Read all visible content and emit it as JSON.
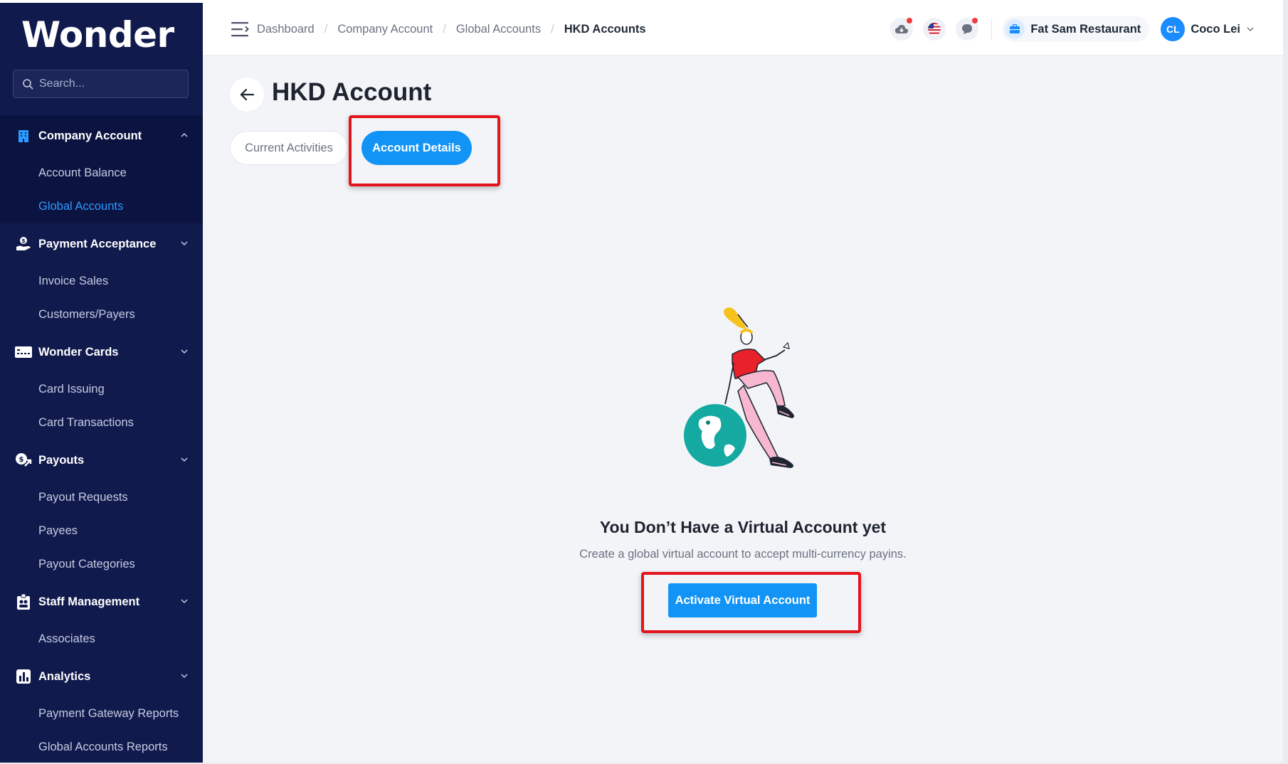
{
  "app": {
    "brand": "Wonder"
  },
  "search": {
    "placeholder": "Search..."
  },
  "sidebar": {
    "sections": [
      {
        "label": "Company Account",
        "icon": "building-icon",
        "expanded": true,
        "items": [
          {
            "label": "Account Balance"
          },
          {
            "label": "Global Accounts",
            "active": true
          }
        ]
      },
      {
        "label": "Payment Acceptance",
        "icon": "hand-dollar-icon",
        "items": [
          {
            "label": "Invoice Sales"
          },
          {
            "label": "Customers/Payers"
          }
        ]
      },
      {
        "label": "Wonder Cards",
        "icon": "card-icon",
        "items": [
          {
            "label": "Card Issuing"
          },
          {
            "label": "Card Transactions"
          }
        ]
      },
      {
        "label": "Payouts",
        "icon": "payout-icon",
        "items": [
          {
            "label": "Payout Requests"
          },
          {
            "label": "Payees"
          },
          {
            "label": "Payout Categories"
          }
        ]
      },
      {
        "label": "Staff Management",
        "icon": "staff-badge-icon",
        "items": [
          {
            "label": "Associates"
          }
        ]
      },
      {
        "label": "Analytics",
        "icon": "bar-chart-icon",
        "items": [
          {
            "label": "Payment Gateway Reports"
          },
          {
            "label": "Global Accounts Reports"
          }
        ]
      }
    ]
  },
  "breadcrumb": [
    "Dashboard",
    "Company Account",
    "Global Accounts",
    "HKD Accounts"
  ],
  "header": {
    "company": "Fat Sam Restaurant",
    "user": {
      "initials": "CL",
      "name": "Coco Lei"
    }
  },
  "page": {
    "title": "HKD Account",
    "tabs": [
      {
        "label": "Current Activities"
      },
      {
        "label": "Account Details",
        "active": true
      }
    ],
    "empty_state": {
      "title": "You Don’t Have a Virtual Account yet",
      "subtitle": "Create a global virtual account to accept multi-currency payins.",
      "button": "Activate Virtual Account"
    }
  },
  "colors": {
    "sidebar": "#111a4c",
    "accent": "#1294f6",
    "highlight": "#e3141b",
    "notification": "#ef3b3b"
  }
}
